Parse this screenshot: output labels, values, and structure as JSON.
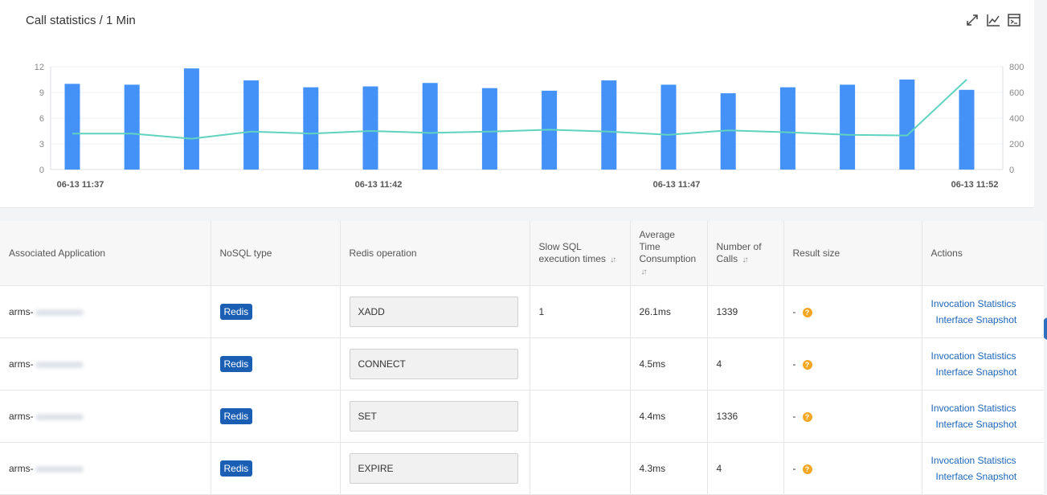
{
  "chart_card": {
    "title": "Call statistics / 1 Min",
    "toolbar": [
      {
        "name": "expand-icon"
      },
      {
        "name": "line-chart-icon"
      },
      {
        "name": "terminal-icon"
      }
    ]
  },
  "chart_data": {
    "type": "bar+line",
    "x_ticks": [
      "06-13 11:37",
      "06-13 11:42",
      "06-13 11:47",
      "06-13 11:52"
    ],
    "y_left_ticks": [
      "0",
      "3",
      "6",
      "9",
      "12"
    ],
    "y_right_ticks": [
      "0",
      "200",
      "400",
      "600",
      "800"
    ],
    "y_left_range": [
      0,
      12
    ],
    "y_right_range": [
      0,
      800
    ],
    "series": [
      {
        "type": "bar",
        "axis": "left",
        "color": "#4492f7",
        "values": [
          10.0,
          9.9,
          11.8,
          10.4,
          9.6,
          9.7,
          10.1,
          9.5,
          9.2,
          10.4,
          9.9,
          8.9,
          9.6,
          9.9,
          10.5,
          9.3
        ]
      },
      {
        "type": "line",
        "axis": "right",
        "color": "#5fd3bf",
        "values": [
          280,
          280,
          240,
          295,
          280,
          300,
          285,
          295,
          310,
          295,
          270,
          305,
          290,
          270,
          265,
          700
        ]
      }
    ],
    "grid": true
  },
  "table": {
    "headers": [
      {
        "label": "Associated Application",
        "sortable": false
      },
      {
        "label": "NoSQL type",
        "sortable": false
      },
      {
        "label": "Redis operation",
        "sortable": false
      },
      {
        "label": "Slow SQL execution times",
        "sortable": true
      },
      {
        "label": "Average Time Consumption",
        "sortable": true
      },
      {
        "label": "Number of Calls",
        "sortable": true
      },
      {
        "label": "Result size",
        "sortable": false
      },
      {
        "label": "Actions",
        "sortable": false
      }
    ],
    "rows": [
      {
        "app": "arms-",
        "nosql": "Redis",
        "op": "XADD",
        "slow": "1",
        "avg": "26.1ms",
        "calls": "1339",
        "result": "-",
        "action1": "Invocation Statistics",
        "action2": "Interface Snapshot"
      },
      {
        "app": "arms-",
        "nosql": "Redis",
        "op": "CONNECT",
        "slow": "",
        "avg": "4.5ms",
        "calls": "4",
        "result": "-",
        "action1": "Invocation Statistics",
        "action2": "Interface Snapshot"
      },
      {
        "app": "arms-",
        "nosql": "Redis",
        "op": "SET",
        "slow": "",
        "avg": "4.4ms",
        "calls": "1336",
        "result": "-",
        "action1": "Invocation Statistics",
        "action2": "Interface Snapshot"
      },
      {
        "app": "arms-",
        "nosql": "Redis",
        "op": "EXPIRE",
        "slow": "",
        "avg": "4.3ms",
        "calls": "4",
        "result": "-",
        "action1": "Invocation Statistics",
        "action2": "Interface Snapshot"
      }
    ],
    "help_symbol": "?",
    "sort_symbol": "↓↑"
  }
}
